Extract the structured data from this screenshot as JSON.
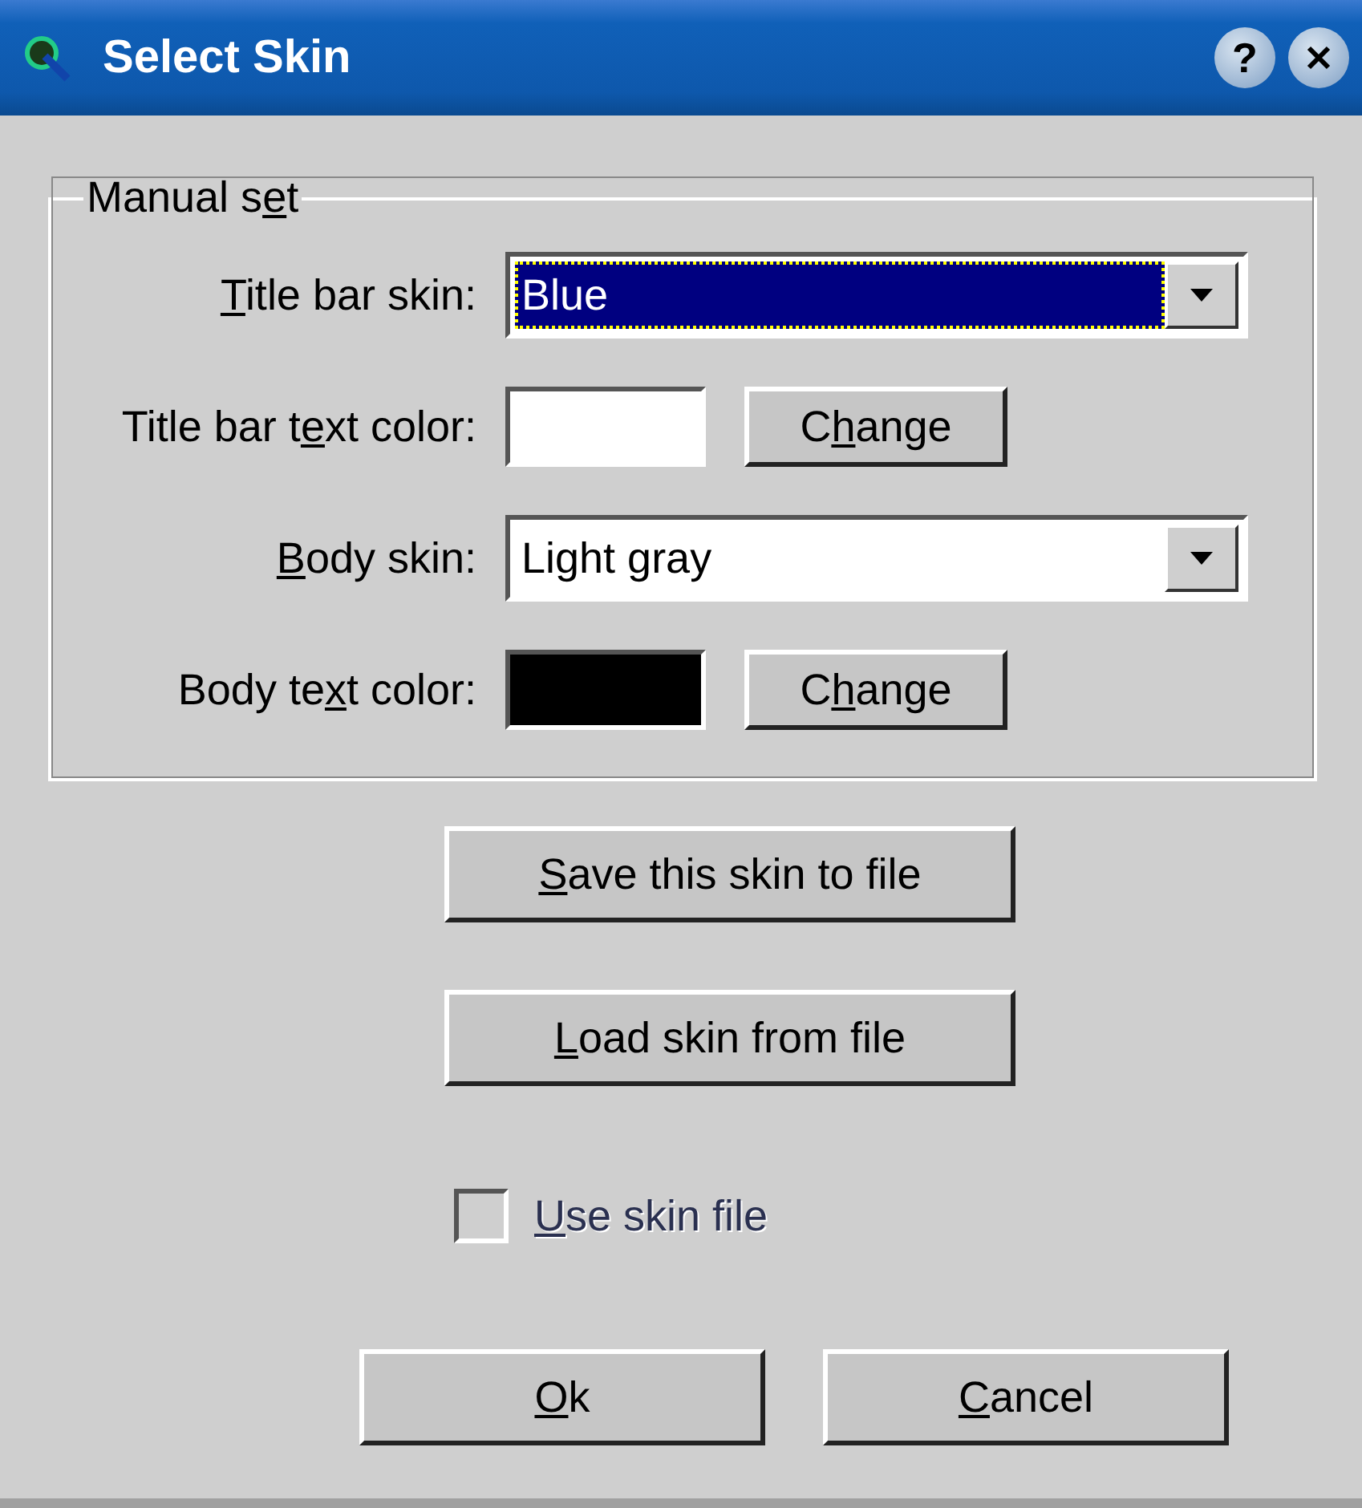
{
  "window": {
    "title": "Select Skin",
    "help_button": "?"
  },
  "group": {
    "label": {
      "pre": "Manual s",
      "key": "e",
      "post": "t"
    },
    "rows": [
      {
        "kind": "combo",
        "label": {
          "key": "T",
          "post": "itle bar skin:"
        },
        "value": "Blue",
        "focused": true
      },
      {
        "kind": "color",
        "label": {
          "pre": "Title bar t",
          "key": "e",
          "post": "xt color:"
        },
        "color": "#ffffff",
        "button": {
          "pre": "C",
          "key": "h",
          "post": "ange"
        }
      },
      {
        "kind": "combo",
        "label": {
          "key": "B",
          "post": "ody skin:"
        },
        "value": "Light gray",
        "focused": false
      },
      {
        "kind": "color",
        "label": {
          "pre": "Body te",
          "key": "x",
          "post": "t color:"
        },
        "color": "#000000",
        "button": {
          "pre": "C",
          "key": "h",
          "post": "ange"
        }
      }
    ]
  },
  "file_buttons": [
    {
      "key": "S",
      "post": "ave this skin to file"
    },
    {
      "key": "L",
      "post": "oad skin from file"
    }
  ],
  "use_skin_file": {
    "label": {
      "key": "U",
      "post": "se skin file"
    },
    "checked": false,
    "disabled": true
  },
  "buttons": [
    {
      "key": "O",
      "post": "k"
    },
    {
      "key": "C",
      "post": "ancel"
    }
  ]
}
